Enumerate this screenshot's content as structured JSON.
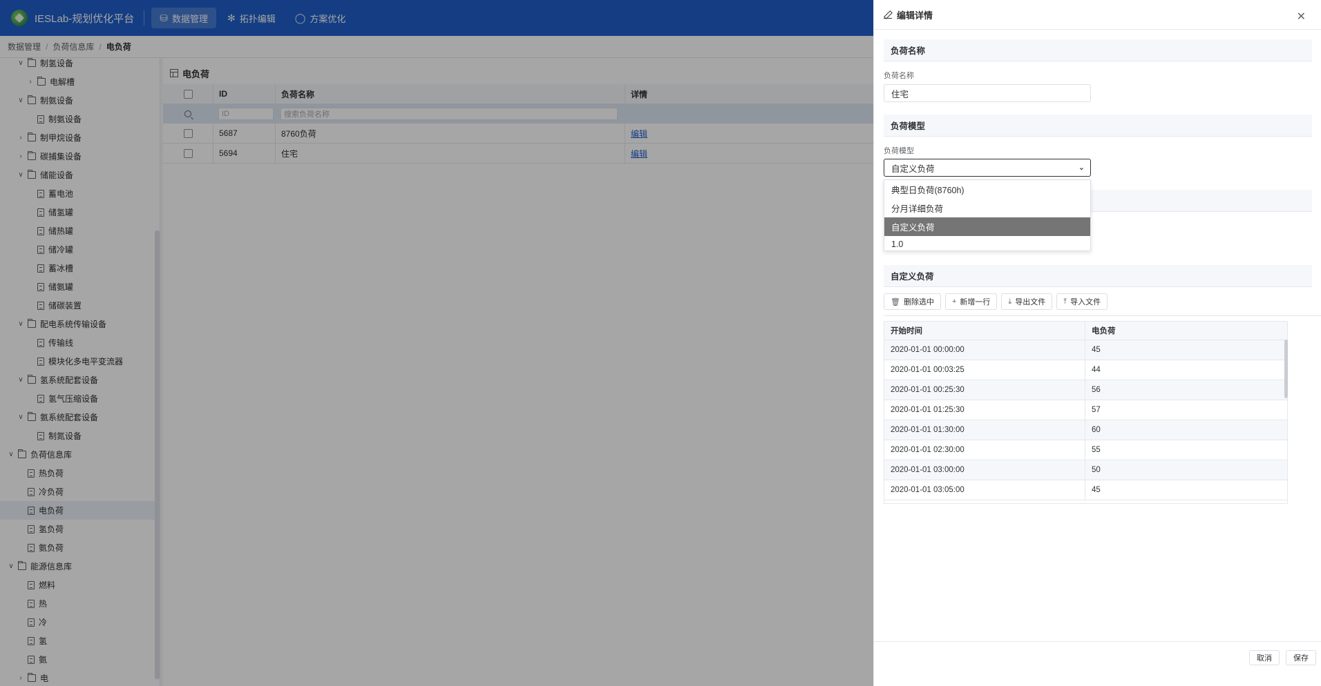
{
  "app": {
    "title": "IESLab-规划优化平台"
  },
  "nav": [
    {
      "label": "数据管理",
      "icon": "database-icon",
      "active": true
    },
    {
      "label": "拓扑编辑",
      "icon": "topology-icon",
      "active": false
    },
    {
      "label": "方案优化",
      "icon": "bulb-icon",
      "active": false
    }
  ],
  "breadcrumb": [
    "数据管理",
    "负荷信息库",
    "电负荷"
  ],
  "sidebar": {
    "items": [
      {
        "label": "制氢设备",
        "level": 2,
        "type": "folder",
        "caret": "down"
      },
      {
        "label": "电解槽",
        "level": 3,
        "type": "folder",
        "caret": "right"
      },
      {
        "label": "制氨设备",
        "level": 2,
        "type": "folder",
        "caret": "down"
      },
      {
        "label": "制氨设备",
        "level": 3,
        "type": "doc",
        "caret": ""
      },
      {
        "label": "制甲烷设备",
        "level": 2,
        "type": "folder",
        "caret": "right"
      },
      {
        "label": "碳捕集设备",
        "level": 2,
        "type": "folder",
        "caret": "right"
      },
      {
        "label": "储能设备",
        "level": 2,
        "type": "folder",
        "caret": "down"
      },
      {
        "label": "蓄电池",
        "level": 3,
        "type": "doc",
        "caret": ""
      },
      {
        "label": "储氢罐",
        "level": 3,
        "type": "doc",
        "caret": ""
      },
      {
        "label": "储热罐",
        "level": 3,
        "type": "doc",
        "caret": ""
      },
      {
        "label": "储冷罐",
        "level": 3,
        "type": "doc",
        "caret": ""
      },
      {
        "label": "蓄冰槽",
        "level": 3,
        "type": "doc",
        "caret": ""
      },
      {
        "label": "储氨罐",
        "level": 3,
        "type": "doc",
        "caret": ""
      },
      {
        "label": "储碳装置",
        "level": 3,
        "type": "doc",
        "caret": ""
      },
      {
        "label": "配电系统传输设备",
        "level": 2,
        "type": "folder",
        "caret": "down"
      },
      {
        "label": "传输线",
        "level": 3,
        "type": "doc",
        "caret": ""
      },
      {
        "label": "模块化多电平变流器",
        "level": 3,
        "type": "doc",
        "caret": ""
      },
      {
        "label": "氢系统配套设备",
        "level": 2,
        "type": "folder",
        "caret": "down"
      },
      {
        "label": "氢气压缩设备",
        "level": 3,
        "type": "doc",
        "caret": ""
      },
      {
        "label": "氨系统配套设备",
        "level": 2,
        "type": "folder",
        "caret": "down"
      },
      {
        "label": "制氮设备",
        "level": 3,
        "type": "doc",
        "caret": ""
      },
      {
        "label": "负荷信息库",
        "level": 1,
        "type": "folder",
        "caret": "down"
      },
      {
        "label": "热负荷",
        "level": 2,
        "type": "doc",
        "caret": ""
      },
      {
        "label": "冷负荷",
        "level": 2,
        "type": "doc",
        "caret": ""
      },
      {
        "label": "电负荷",
        "level": 2,
        "type": "doc",
        "caret": "",
        "selected": true
      },
      {
        "label": "氢负荷",
        "level": 2,
        "type": "doc",
        "caret": ""
      },
      {
        "label": "氨负荷",
        "level": 2,
        "type": "doc",
        "caret": ""
      },
      {
        "label": "能源信息库",
        "level": 1,
        "type": "folder",
        "caret": "down"
      },
      {
        "label": "燃料",
        "level": 2,
        "type": "doc",
        "caret": ""
      },
      {
        "label": "热",
        "level": 2,
        "type": "doc",
        "caret": ""
      },
      {
        "label": "冷",
        "level": 2,
        "type": "doc",
        "caret": ""
      },
      {
        "label": "氢",
        "level": 2,
        "type": "doc",
        "caret": ""
      },
      {
        "label": "氨",
        "level": 2,
        "type": "doc",
        "caret": ""
      },
      {
        "label": "电",
        "level": 2,
        "type": "folder",
        "caret": "right"
      }
    ]
  },
  "main": {
    "title": "电负荷",
    "columns": {
      "id": "ID",
      "name": "负荷名称",
      "detail": "详情"
    },
    "filter": {
      "id_placeholder": "ID",
      "name_placeholder": "搜索负荷名称"
    },
    "rows": [
      {
        "id": "5687",
        "name": "8760负荷",
        "action": "编辑"
      },
      {
        "id": "5694",
        "name": "住宅",
        "action": "编辑"
      }
    ]
  },
  "drawer": {
    "title": "编辑详情",
    "section_name": "负荷名称",
    "name_label": "负荷名称",
    "name_value": "住宅",
    "section_model": "负荷模型",
    "model_label": "负荷模型",
    "model_value": "自定义负荷",
    "model_options": [
      "典型日负荷(8760h)",
      "分月详细负荷",
      "自定义负荷",
      "1.0"
    ],
    "model_selected_index": 2,
    "section_custom": "自定义负荷",
    "buttons": {
      "delete": "删除选中",
      "add_row": "新增一行",
      "export": "导出文件",
      "import": "导入文件"
    },
    "table": {
      "columns": [
        "开始时间",
        "电负荷"
      ],
      "rows": [
        [
          "2020-01-01 00:00:00",
          "45"
        ],
        [
          "2020-01-01 00:03:25",
          "44"
        ],
        [
          "2020-01-01 00:25:30",
          "56"
        ],
        [
          "2020-01-01 01:25:30",
          "57"
        ],
        [
          "2020-01-01 01:30:00",
          "60"
        ],
        [
          "2020-01-01 02:30:00",
          "55"
        ],
        [
          "2020-01-01 03:00:00",
          "50"
        ],
        [
          "2020-01-01 03:05:00",
          "45"
        ]
      ]
    },
    "cancel": "取消",
    "save": "保存"
  }
}
